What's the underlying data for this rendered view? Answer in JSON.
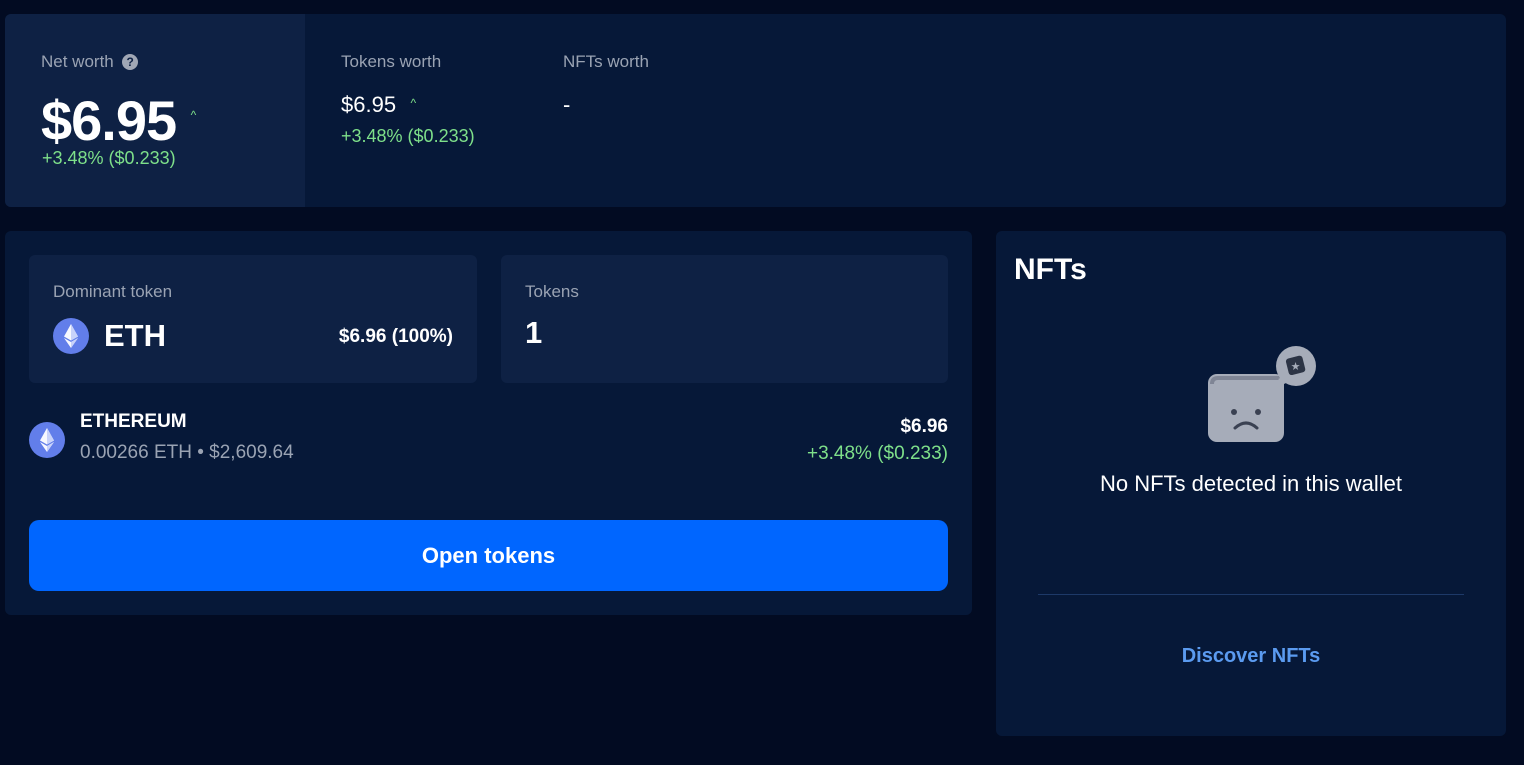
{
  "summary": {
    "net_worth": {
      "label": "Net worth",
      "help_glyph": "?",
      "value": "$6.95",
      "trend_glyph": "^",
      "change": "+3.48% ($0.233)"
    },
    "tokens_worth": {
      "label": "Tokens worth",
      "value": "$6.95",
      "trend_glyph": "^",
      "change": "+3.48% ($0.233)"
    },
    "nfts_worth": {
      "label": "NFTs worth",
      "value": "-"
    }
  },
  "dominant_token": {
    "label": "Dominant token",
    "symbol": "ETH",
    "value": "$6.96 (100%)",
    "icon": "ethereum-icon"
  },
  "tokens_count": {
    "label": "Tokens",
    "value": "1"
  },
  "token_list": [
    {
      "name": "ETHEREUM",
      "detail": "0.00266 ETH • $2,609.64",
      "value": "$6.96",
      "change": "+3.48% ($0.233)",
      "icon": "ethereum-icon"
    }
  ],
  "open_tokens_label": "Open tokens",
  "nfts": {
    "title": "NFTs",
    "empty_text": "No NFTs detected in this wallet",
    "empty_icon": "empty-wallet-icon",
    "discover_label": "Discover NFTs"
  },
  "colors": {
    "background": "#020b22",
    "panel": "#061838",
    "card": "#0e2144",
    "positive": "#7ee08a",
    "accent_button": "#0066ff",
    "link": "#5b9bf0",
    "eth": "#627eea"
  }
}
